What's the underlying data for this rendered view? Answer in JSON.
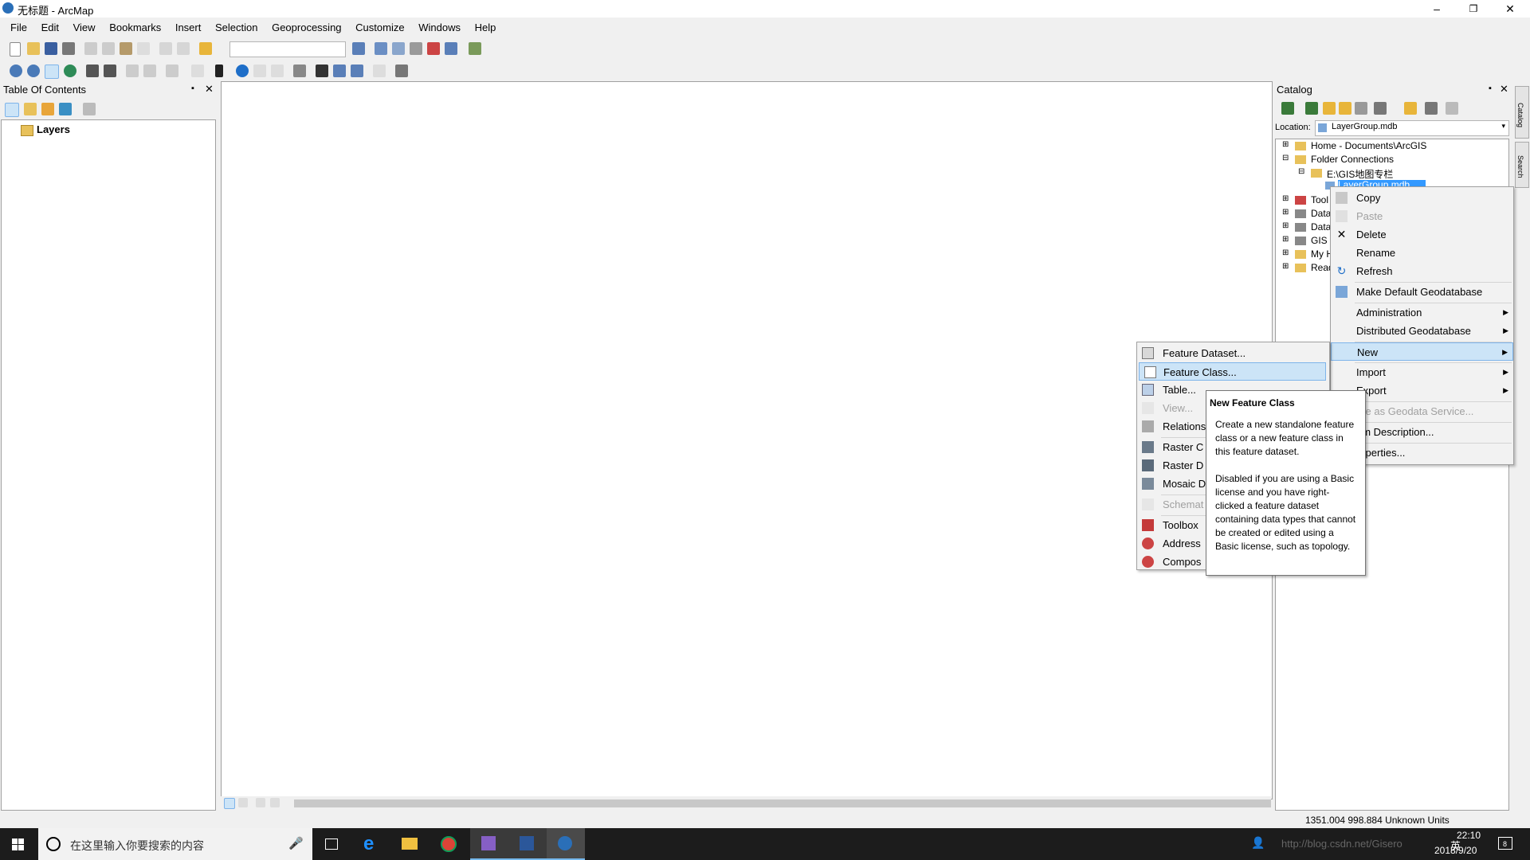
{
  "window": {
    "title": "无标题 - ArcMap",
    "controls": {
      "minimize": "–",
      "restore": "❐",
      "close": "✕"
    }
  },
  "menubar": [
    "File",
    "Edit",
    "View",
    "Bookmarks",
    "Insert",
    "Selection",
    "Geoprocessing",
    "Customize",
    "Windows",
    "Help"
  ],
  "toc": {
    "title": "Table Of Contents",
    "pin": "📌",
    "close": "✕",
    "layers_label": "Layers"
  },
  "catalog": {
    "title": "Catalog",
    "location_label": "Location:",
    "location_value": "LayerGroup.mdb",
    "side_tabs": [
      "Catalog",
      "Search"
    ],
    "tree": {
      "home": "Home - Documents\\ArcGIS",
      "folder_connections": "Folder Connections",
      "gis_folder": "E:\\GIS地图专栏",
      "selected_item": "LayerGroup.mdb",
      "partials": [
        "Tool",
        "Data",
        "Data",
        "GIS",
        "My H",
        "Read"
      ]
    }
  },
  "context_menu": {
    "items": [
      {
        "label": "Copy",
        "icon": "copy-icon",
        "enabled": true
      },
      {
        "label": "Paste",
        "icon": "paste-icon",
        "enabled": false
      },
      {
        "label": "Delete",
        "icon": "delete-icon",
        "enabled": true
      },
      {
        "label": "Rename",
        "icon": "",
        "enabled": true
      },
      {
        "label": "Refresh",
        "icon": "refresh-icon",
        "enabled": true
      },
      {
        "label": "Make Default Geodatabase",
        "icon": "geodatabase-icon",
        "enabled": true
      },
      {
        "label": "Administration",
        "submenu": true,
        "enabled": true
      },
      {
        "label": "Distributed Geodatabase",
        "submenu": true,
        "enabled": true
      },
      {
        "label": "New",
        "submenu": true,
        "enabled": true,
        "highlighted": true
      },
      {
        "label": "Import",
        "submenu": true,
        "enabled": true
      },
      {
        "label": "Export",
        "submenu": true,
        "enabled": true
      },
      {
        "label": "are as Geodata Service...",
        "enabled": false
      },
      {
        "label": "em Description...",
        "enabled": true
      },
      {
        "label": "roperties...",
        "enabled": true
      }
    ]
  },
  "new_submenu": {
    "items": [
      {
        "label": "Feature Dataset...",
        "icon": "feature-dataset-icon",
        "enabled": true
      },
      {
        "label": "Feature Class...",
        "icon": "feature-class-icon",
        "enabled": true,
        "highlighted": true
      },
      {
        "label": "Table...",
        "icon": "table-icon",
        "enabled": true
      },
      {
        "label": "View...",
        "icon": "view-icon",
        "enabled": false
      },
      {
        "label": "Relations",
        "icon": "relationship-icon",
        "enabled": true
      },
      {
        "label": "Raster C",
        "icon": "raster-catalog-icon",
        "enabled": true
      },
      {
        "label": "Raster D",
        "icon": "raster-dataset-icon",
        "enabled": true
      },
      {
        "label": "Mosaic D",
        "icon": "mosaic-dataset-icon",
        "enabled": true
      },
      {
        "label": "Schemat",
        "icon": "schematic-icon",
        "enabled": false
      },
      {
        "label": "Toolbox",
        "icon": "toolbox-icon",
        "enabled": true
      },
      {
        "label": "Address",
        "icon": "address-locator-icon",
        "enabled": true
      },
      {
        "label": "Compos",
        "icon": "composite-locator-icon",
        "enabled": true
      }
    ]
  },
  "tooltip": {
    "title": "New Feature Class",
    "para1": "Create a new standalone feature class or a new feature class in this feature dataset.",
    "para2": "Disabled if you are using a Basic license and you have right-clicked a feature dataset containing data types that cannot be created or edited using a Basic license, such as topology."
  },
  "status": {
    "coords": "1351.004  998.884 Unknown Units"
  },
  "taskbar": {
    "search_placeholder": "在这里输入你要搜索的内容",
    "time": "22:10",
    "date": "2018/9/20",
    "ime": "英",
    "notif_count": "8",
    "watermark": "http://blog.csdn.net/Gisero"
  },
  "colors": {
    "highlight": "#cce4f7",
    "highlight_border": "#7eb4ea",
    "taskbar": "#1c1c1c"
  }
}
